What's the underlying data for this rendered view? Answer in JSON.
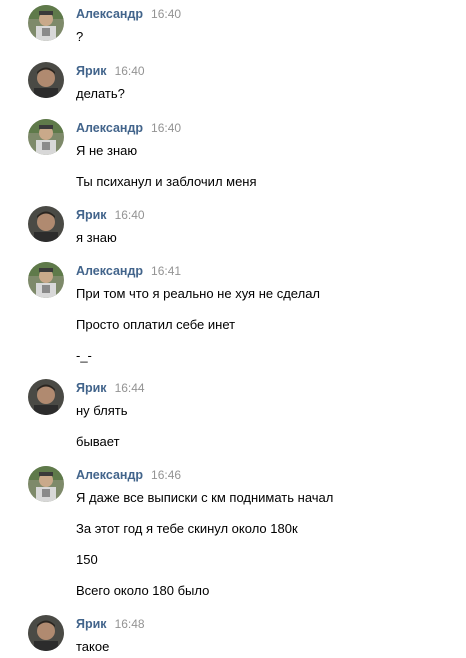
{
  "messages": [
    {
      "author": "Александр",
      "time": "16:40",
      "avatar": "alexander-avatar",
      "lines": [
        "?"
      ]
    },
    {
      "author": "Ярик",
      "time": "16:40",
      "avatar": "yarik-avatar",
      "lines": [
        "делать?"
      ]
    },
    {
      "author": "Александр",
      "time": "16:40",
      "avatar": "alexander-avatar",
      "lines": [
        "Я не знаю",
        "Ты психанул и заблочил меня"
      ]
    },
    {
      "author": "Ярик",
      "time": "16:40",
      "avatar": "yarik-avatar",
      "lines": [
        "я знаю"
      ]
    },
    {
      "author": "Александр",
      "time": "16:41",
      "avatar": "alexander-avatar",
      "lines": [
        "При том что я реально не хуя не сделал",
        "Просто оплатил себе инет",
        "-_-"
      ]
    },
    {
      "author": "Ярик",
      "time": "16:44",
      "avatar": "yarik-avatar",
      "lines": [
        "ну блять",
        "бывает"
      ]
    },
    {
      "author": "Александр",
      "time": "16:46",
      "avatar": "alexander-avatar",
      "lines": [
        "Я даже все выписки с км поднимать начал",
        "За этот год я тебе скинул около 180к",
        "150",
        "Всего около 180 было"
      ]
    },
    {
      "author": "Ярик",
      "time": "16:48",
      "avatar": "yarik-avatar",
      "lines": [
        "такое"
      ]
    }
  ]
}
